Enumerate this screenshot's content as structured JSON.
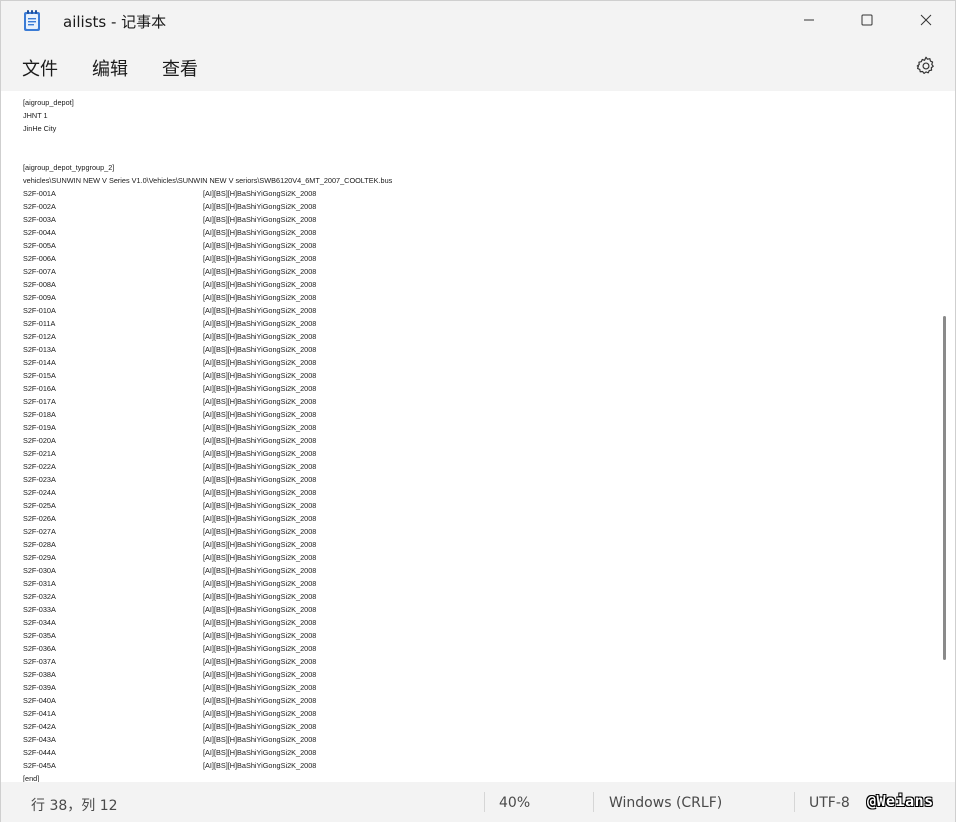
{
  "window": {
    "title": "ailists - 记事本",
    "icons": {
      "app": "notepad-icon",
      "minimize": "minimize-icon",
      "maximize": "maximize-icon",
      "close": "close-icon"
    }
  },
  "menu": {
    "file": "文件",
    "edit": "编辑",
    "view": "查看",
    "settings_icon": "gear-icon"
  },
  "editor": {
    "header_lines": [
      "[aigroup_depot]",
      "JHNT 1",
      "JinHe City",
      "",
      "",
      "[aigroup_depot_typgroup_2]",
      "vehicles\\SUNWIN NEW V Series V1.0\\Vehicles\\SUNWIN NEW V seriors\\SWB6120V4_6MT_2007_COOLTEK.bus"
    ],
    "rows": [
      [
        "S2F-001A",
        "[AI][BS][H]BaShiYiGongSi2K_2008"
      ],
      [
        "S2F-002A",
        "[AI][BS][H]BaShiYiGongSi2K_2008"
      ],
      [
        "S2F-003A",
        "[AI][BS][H]BaShiYiGongSi2K_2008"
      ],
      [
        "S2F-004A",
        "[AI][BS][H]BaShiYiGongSi2K_2008"
      ],
      [
        "S2F-005A",
        "[AI][BS][H]BaShiYiGongSi2K_2008"
      ],
      [
        "S2F-006A",
        "[AI][BS][H]BaShiYiGongSi2K_2008"
      ],
      [
        "S2F-007A",
        "[AI][BS][H]BaShiYiGongSi2K_2008"
      ],
      [
        "S2F-008A",
        "[AI][BS][H]BaShiYiGongSi2K_2008"
      ],
      [
        "S2F-009A",
        "[AI][BS][H]BaShiYiGongSi2K_2008"
      ],
      [
        "S2F-010A",
        "[AI][BS][H]BaShiYiGongSi2K_2008"
      ],
      [
        "S2F-011A",
        "[AI][BS][H]BaShiYiGongSi2K_2008"
      ],
      [
        "S2F-012A",
        "[AI][BS][H]BaShiYiGongSi2K_2008"
      ],
      [
        "S2F-013A",
        "[AI][BS][H]BaShiYiGongSi2K_2008"
      ],
      [
        "S2F-014A",
        "[AI][BS][H]BaShiYiGongSi2K_2008"
      ],
      [
        "S2F-015A",
        "[AI][BS][H]BaShiYiGongSi2K_2008"
      ],
      [
        "S2F-016A",
        "[AI][BS][H]BaShiYiGongSi2K_2008"
      ],
      [
        "S2F-017A",
        "[AI][BS][H]BaShiYiGongSi2K_2008"
      ],
      [
        "S2F-018A",
        "[AI][BS][H]BaShiYiGongSi2K_2008"
      ],
      [
        "S2F-019A",
        "[AI][BS][H]BaShiYiGongSi2K_2008"
      ],
      [
        "S2F-020A",
        "[AI][BS][H]BaShiYiGongSi2K_2008"
      ],
      [
        "S2F-021A",
        "[AI][BS][H]BaShiYiGongSi2K_2008"
      ],
      [
        "S2F-022A",
        "[AI][BS][H]BaShiYiGongSi2K_2008"
      ],
      [
        "S2F-023A",
        "[AI][BS][H]BaShiYiGongSi2K_2008"
      ],
      [
        "S2F-024A",
        "[AI][BS][H]BaShiYiGongSi2K_2008"
      ],
      [
        "S2F-025A",
        "[AI][BS][H]BaShiYiGongSi2K_2008"
      ],
      [
        "S2F-026A",
        "[AI][BS][H]BaShiYiGongSi2K_2008"
      ],
      [
        "S2F-027A",
        "[AI][BS][H]BaShiYiGongSi2K_2008"
      ],
      [
        "S2F-028A",
        "[AI][BS][H]BaShiYiGongSi2K_2008"
      ],
      [
        "S2F-029A",
        "[AI][BS][H]BaShiYiGongSi2K_2008"
      ],
      [
        "S2F-030A",
        "[AI][BS][H]BaShiYiGongSi2K_2008"
      ],
      [
        "S2F-031A",
        "[AI][BS][H]BaShiYiGongSi2K_2008"
      ],
      [
        "S2F-032A",
        "[AI][BS][H]BaShiYiGongSi2K_2008"
      ],
      [
        "S2F-033A",
        "[AI][BS][H]BaShiYiGongSi2K_2008"
      ],
      [
        "S2F-034A",
        "[AI][BS][H]BaShiYiGongSi2K_2008"
      ],
      [
        "S2F-035A",
        "[AI][BS][H]BaShiYiGongSi2K_2008"
      ],
      [
        "S2F-036A",
        "[AI][BS][H]BaShiYiGongSi2K_2008"
      ],
      [
        "S2F-037A",
        "[AI][BS][H]BaShiYiGongSi2K_2008"
      ],
      [
        "S2F-038A",
        "[AI][BS][H]BaShiYiGongSi2K_2008"
      ],
      [
        "S2F-039A",
        "[AI][BS][H]BaShiYiGongSi2K_2008"
      ],
      [
        "S2F-040A",
        "[AI][BS][H]BaShiYiGongSi2K_2008"
      ],
      [
        "S2F-041A",
        "[AI][BS][H]BaShiYiGongSi2K_2008"
      ],
      [
        "S2F-042A",
        "[AI][BS][H]BaShiYiGongSi2K_2008"
      ],
      [
        "S2F-043A",
        "[AI][BS][H]BaShiYiGongSi2K_2008"
      ],
      [
        "S2F-044A",
        "[AI][BS][H]BaShiYiGongSi2K_2008"
      ],
      [
        "S2F-045A",
        "[AI][BS][H]BaShiYiGongSi2K_2008"
      ]
    ],
    "footer_lines": [
      "[end]"
    ]
  },
  "status": {
    "position": "行 38，列 12",
    "zoom": "40%",
    "line_ending": "Windows (CRLF)",
    "encoding": "UTF-8",
    "watermark": "@Weians"
  }
}
